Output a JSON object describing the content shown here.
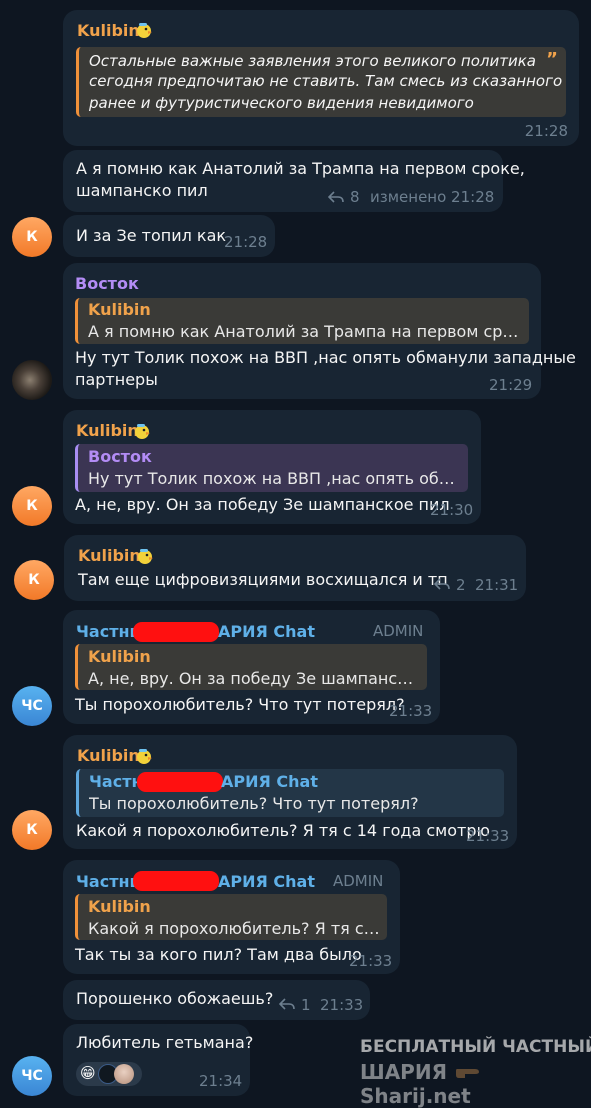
{
  "messages": {
    "m1": {
      "sender": "Kulibin",
      "quote": "Остальные важные заявления этого великого политика сегодня предпочитаю не ставить. Там смесь из сказанного ранее и футуристического видения невидимого",
      "quote_l1": "Остальные важные заявления этого великого политика",
      "quote_l2": "сегодня предпочитаю не ставить. Там смесь из сказанного",
      "quote_l3": "ранее и футуристического видения невидимого",
      "time": "21:28"
    },
    "m2": {
      "l1": "А я помню как Анатолий за Трампа на первом сроке,",
      "l2": "шампанско пил",
      "replies": "8",
      "edited": "изменено 21:28"
    },
    "m3": {
      "avatar": "К",
      "text": "И за Зе топил как",
      "time": "21:28"
    },
    "m4": {
      "sender": "Восток",
      "quote_name": "Kulibin",
      "quote": "А я помню как Анатолий за Трампа на первом сроке, ...",
      "l1": "Ну тут Толик похож на ВВП ,нас опять обманули западные",
      "l2": "партнеры",
      "time": "21:29"
    },
    "m5": {
      "avatar": "К",
      "sender": "Kulibin",
      "quote_name": "Восток",
      "quote": "Ну тут Толик похож на ВВП ,нас опять обману...",
      "text": "А, не, вру. Он за победу Зе шампанское пил",
      "time": "21:30"
    },
    "m6": {
      "avatar": "К",
      "sender": "Kulibin",
      "text": "Там еще цифровизяциями восхищался и тп",
      "replies": "2",
      "time": "21:31"
    },
    "m7": {
      "avatar": "ЧС",
      "sender_a": "Частны",
      "sender_b": "АРИЯ Chat",
      "role": "ADMIN",
      "quote_name": "Kulibin",
      "quote": "А, не, вру. Он за победу Зе шампанское ...",
      "text": "Ты порохолюбитель? Что тут потерял?",
      "time": "21:33"
    },
    "m8": {
      "avatar": "К",
      "sender": "Kulibin",
      "quote_name_a": "Частны",
      "quote_name_b": "АРИЯ Chat",
      "quote": "Ты порохолюбитель? Что тут потерял?",
      "text": "Какой я порохолюбитель? Я тя с 14 года смотрю",
      "time": "21:33"
    },
    "m9": {
      "sender_a": "Частны",
      "sender_b": "АРИЯ Chat",
      "role": "ADMIN",
      "quote_name": "Kulibin",
      "quote": "Какой я порохолюбитель? Я тя с 14 ...",
      "text": "Так ты за кого пил? Там два было",
      "time": "21:33"
    },
    "m10": {
      "text": "Порошенко обожаешь?",
      "replies": "1",
      "time": "21:33"
    },
    "m11": {
      "avatar": "ЧС",
      "text": "Любитель гетьмана?",
      "reaction": "😁",
      "time": "21:34"
    }
  },
  "watermark": {
    "l1": "БЕСПЛАТНЫЙ ЧАСТНЫЙ",
    "l2a": "ШАРИЯ",
    "l2b": "Sharij.net"
  },
  "colors": {
    "background": "#0e1621",
    "bubble": "#182533",
    "kulibin": "#f0a24b",
    "vostok": "#b38cf5",
    "admin_blue": "#5fb0e8",
    "time": "#6d7f8f"
  }
}
